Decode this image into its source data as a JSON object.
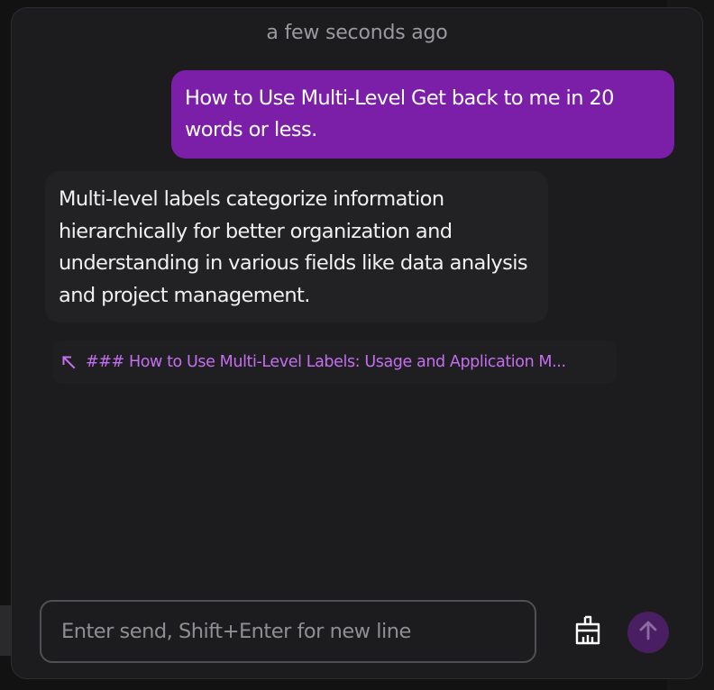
{
  "chat": {
    "timestamp": "a few seconds ago",
    "messages": [
      {
        "role": "user",
        "text": "How to Use Multi-Level Get back to me in 20 words or less."
      },
      {
        "role": "assistant",
        "text": "Multi-level labels categorize information hierarchically for better organization and understanding in various fields like data analysis and project management."
      }
    ],
    "source_link": {
      "icon": "arrow-up-left-icon",
      "text": "### How to Use Multi-Level Labels: Usage and Application M..."
    }
  },
  "composer": {
    "placeholder": "Enter send, Shift+Enter for new line",
    "value": "",
    "clear_icon": "broom-icon",
    "send_icon": "arrow-up-icon"
  },
  "colors": {
    "user_bubble": "#7b1fa8",
    "assistant_bubble": "#222224",
    "link_text": "#c56ef0",
    "send_button": "#4a1e63",
    "panel_bg": "#1c1c1e"
  }
}
